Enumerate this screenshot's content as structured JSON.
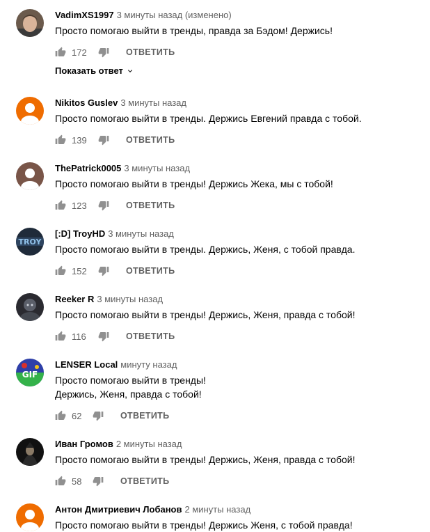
{
  "comments": [
    {
      "author": "VadimXS1997",
      "time": "3 минуты назад (изменено)",
      "lines": [
        "Просто помогаю выйти в тренды, правда за Бэдом! Держись!"
      ],
      "likes": "172",
      "reply": "ОТВЕТИТЬ",
      "show_replies": "Показать ответ",
      "avatar": {
        "type": "photo-face",
        "colors": [
          "#5b4a3e",
          "#d9b49a"
        ]
      }
    },
    {
      "author": "Nikitos Guslev",
      "time": "3 минуты назад",
      "lines": [
        "Просто помогаю выйти в тренды. Держись Евгений правда с тобой."
      ],
      "likes": "139",
      "reply": "ОТВЕТИТЬ",
      "avatar": {
        "type": "default",
        "colors": [
          "#ef6c00"
        ]
      }
    },
    {
      "author": "ThePatrick0005",
      "time": "3 минуты назад",
      "lines": [
        "Просто помогаю выйти в тренды! Держись Жека, мы с тобой!"
      ],
      "likes": "123",
      "reply": "ОТВЕТИТЬ",
      "avatar": {
        "type": "default",
        "colors": [
          "#795548"
        ]
      }
    },
    {
      "author": "[:D] TroyHD",
      "time": "3 минуты назад",
      "lines": [
        "Просто помогаю выйти в тренды. Держись, Женя, с тобой правда."
      ],
      "likes": "152",
      "reply": "ОТВЕТИТЬ",
      "avatar": {
        "type": "photo-dark-blue",
        "colors": [
          "#1f2b3a",
          "#6ea0c8"
        ]
      }
    },
    {
      "author": "Reeker R",
      "time": "3 минуты назад",
      "lines": [
        "Просто помогаю выйти в тренды! Держись, Женя, правда с тобой!"
      ],
      "likes": "116",
      "reply": "ОТВЕТИТЬ",
      "avatar": {
        "type": "photo-dark",
        "colors": [
          "#2a2a30",
          "#6b6f7a"
        ]
      }
    },
    {
      "author": "LENSER Local",
      "time": "минуту назад",
      "lines": [
        "Просто помогаю выйти в тренды!",
        "Держись, Женя, правда с тобой!"
      ],
      "likes": "62",
      "reply": "ОТВЕТИТЬ",
      "avatar": {
        "type": "photo-colorful",
        "colors": [
          "#2e3fa8",
          "#34b24a",
          "#d8302b"
        ]
      }
    },
    {
      "author": "Иван Громов",
      "time": "2 минуты назад",
      "lines": [
        "Просто помогаю выйти в тренды! Держись, Женя, правда с тобой!"
      ],
      "likes": "58",
      "reply": "ОТВЕТИТЬ",
      "avatar": {
        "type": "photo-black",
        "colors": [
          "#111111",
          "#8a7a66"
        ]
      }
    },
    {
      "author": "Антон Дмитриевич Лобанов",
      "time": "2 минуты назад",
      "lines": [
        "Просто помогаю выйти в тренды! Держись Женя, с тобой правда!"
      ],
      "likes": "",
      "reply": "",
      "avatar": {
        "type": "default",
        "colors": [
          "#ef6c00"
        ]
      }
    }
  ],
  "colors": {
    "text": "#030303",
    "secondary": "#606060",
    "icon": "#909090"
  }
}
